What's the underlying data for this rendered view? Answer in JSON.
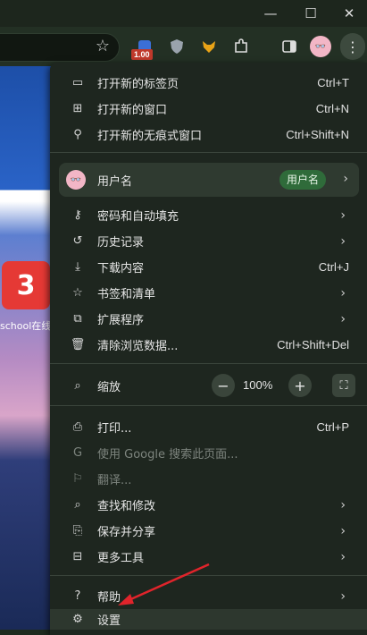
{
  "window": {
    "minimize": "—",
    "maximize": "☐",
    "close": "✕"
  },
  "toolbar": {
    "star": "☆",
    "badge": "1.00",
    "kebab": "⋮",
    "avatar": "👓"
  },
  "page": {
    "label": "school在线"
  },
  "menu": {
    "new_tab": {
      "label": "打开新的标签页",
      "shortcut": "Ctrl+T"
    },
    "new_window": {
      "label": "打开新的窗口",
      "shortcut": "Ctrl+N"
    },
    "incognito": {
      "label": "打开新的无痕式窗口",
      "shortcut": "Ctrl+Shift+N"
    },
    "profile": {
      "name": "用户名",
      "chip": "用户名"
    },
    "passwords": {
      "label": "密码和自动填充"
    },
    "history": {
      "label": "历史记录"
    },
    "downloads": {
      "label": "下载内容",
      "shortcut": "Ctrl+J"
    },
    "bookmarks": {
      "label": "书签和清单"
    },
    "extensions": {
      "label": "扩展程序"
    },
    "clear_data": {
      "label": "清除浏览数据...",
      "shortcut": "Ctrl+Shift+Del"
    },
    "zoom": {
      "label": "缩放",
      "value": "100%",
      "minus": "−",
      "plus": "+"
    },
    "print": {
      "label": "打印...",
      "shortcut": "Ctrl+P"
    },
    "google_search": {
      "label": "使用 Google 搜索此页面..."
    },
    "translate": {
      "label": "翻译..."
    },
    "find_edit": {
      "label": "查找和修改"
    },
    "save_share": {
      "label": "保存并分享"
    },
    "more_tools": {
      "label": "更多工具"
    },
    "help": {
      "label": "帮助"
    },
    "settings": {
      "label": "设置"
    },
    "arrow": "›"
  },
  "colors": {
    "menu_bg": "#1e261f",
    "profile_bg": "#2f3a30",
    "chip": "#2f6b3a",
    "annotation_arrow": "#e0242b"
  }
}
